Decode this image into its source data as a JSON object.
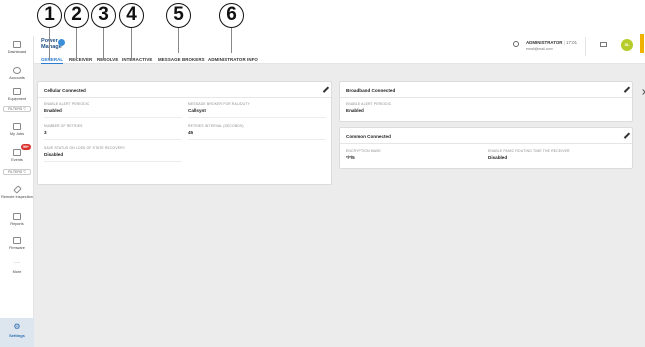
{
  "callouts": [
    "1",
    "2",
    "3",
    "4",
    "5",
    "6"
  ],
  "sidebar": {
    "items": [
      {
        "label": "Dashboard",
        "icon": "dashboard-icon"
      },
      {
        "label": "Accounts",
        "icon": "accounts-icon"
      },
      {
        "label": "Equipment",
        "icon": "equipment-icon"
      },
      {
        "label": "My Jobs",
        "icon": "jobs-icon"
      },
      {
        "label": "Events",
        "icon": "events-icon"
      },
      {
        "label": "Remote Inspection",
        "icon": "remote-inspection-icon"
      },
      {
        "label": "Reports",
        "icon": "reports-icon"
      },
      {
        "label": "Firmware",
        "icon": "firmware-icon"
      },
      {
        "label": "More",
        "icon": "more-icon"
      }
    ],
    "filters": [
      "FILTERS ▽",
      "FILTERS ▽"
    ],
    "events_badge": "99+",
    "settings_label": "Settings"
  },
  "header": {
    "logo_line1": "Power",
    "logo_line2": "Manage",
    "user_name": "ADMINISTRATOR",
    "user_time": "17:01",
    "user_email": "email@mail.com",
    "avatar_initials": "SL",
    "accent_color": "#f0b400"
  },
  "tabs": [
    {
      "label": "GENERAL",
      "active": true
    },
    {
      "label": "RECEIVER",
      "active": false
    },
    {
      "label": "RESOLVE",
      "active": false
    },
    {
      "label": "INTERACTIVE",
      "active": false
    },
    {
      "label": "MESSAGE BROKERS",
      "active": false
    },
    {
      "label": "ADMINISTRATOR INFO",
      "active": false
    }
  ],
  "cards": {
    "cellular": {
      "title": "Cellular Connected",
      "fields": [
        {
          "label": "ENABLE ALERT PERIODIC",
          "value": "Enabled"
        },
        {
          "label": "MESSAGE BROKER FOR RALIDUTY",
          "value": "Callsynt"
        },
        {
          "label": "NUMBER OF RETRIES",
          "value": "3"
        },
        {
          "label": "RETRIES INTERVAL (SECONDS)",
          "value": "45"
        },
        {
          "label": "SAVE STATUS ON LOSS OF STATE RECOVERY",
          "value": "Disabled"
        }
      ]
    },
    "broadband": {
      "title": "Broadband Connected",
      "fields": [
        {
          "label": "ENABLE ALERT PERIODIC",
          "value": "Enabled"
        }
      ]
    },
    "common": {
      "title": "Common Connected",
      "fields": [
        {
          "label": "ENCRYPTION MASK",
          "value": "*/*/5"
        },
        {
          "label": "ENABLE PANIC ROUTING TIME THE RECEIVER",
          "value": "Disabled"
        }
      ]
    }
  }
}
